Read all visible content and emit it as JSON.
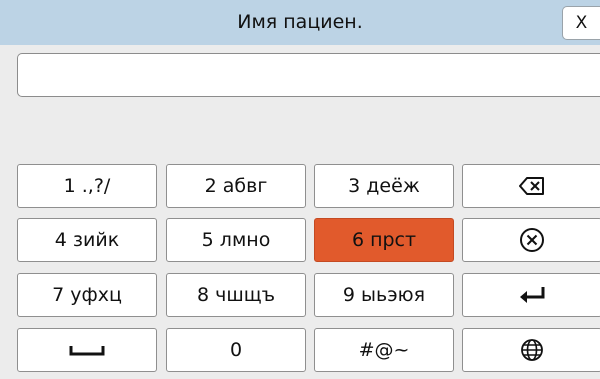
{
  "dialog": {
    "title": "Имя пациен.",
    "close_label": "X",
    "input_value": ""
  },
  "keypad": {
    "rows": [
      [
        "1 .,?/",
        "2 абвг",
        "3 деёж",
        ""
      ],
      [
        "4 зийк",
        "5 лмно",
        "6 прст",
        ""
      ],
      [
        "7 уфхц",
        "8 чшщъ",
        "9 ыьэюя",
        ""
      ],
      [
        "",
        "0",
        "#@~",
        ""
      ]
    ],
    "active_key": "6 прст",
    "icons": [
      "backspace-icon",
      "clear-icon",
      "enter-icon",
      "space-icon",
      "globe-icon"
    ]
  },
  "colors": {
    "title_bar": "#bcd3e5",
    "background": "#ececec",
    "active_key": "#e15a2c"
  }
}
